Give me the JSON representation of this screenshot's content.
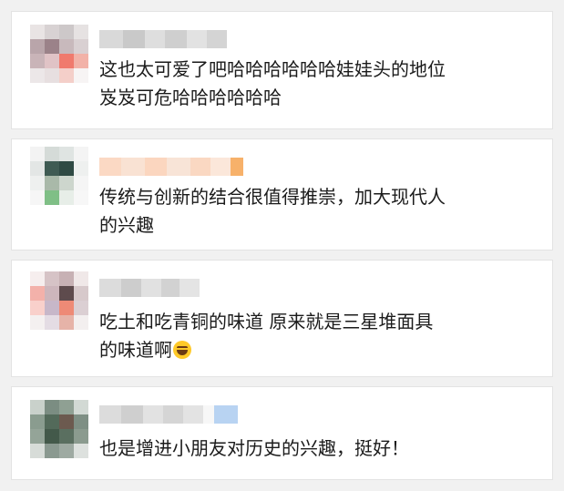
{
  "comments": [
    {
      "text_line1": "这也太可爱了吧哈哈哈哈哈哈娃娃头的地位",
      "text_line2": "岌岌可危哈哈哈哈哈哈"
    },
    {
      "text_line1": "传统与创新的结合很值得推崇，加大现代人",
      "text_line2": "的兴趣"
    },
    {
      "text_line1": "吃土和吃青铜的味道 原来就是三星堆面具",
      "text_line2": "的味道啊",
      "emoji": "laughing-tears-emoji"
    },
    {
      "text_line1": "也是增进小朋友对历史的兴趣，挺好！"
    }
  ]
}
